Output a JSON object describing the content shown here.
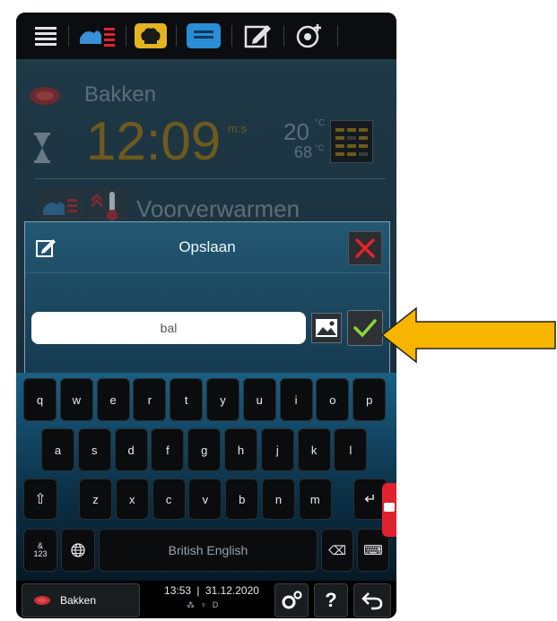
{
  "program": {
    "name": "Bakken",
    "time": "12:09",
    "time_unit": "m:s",
    "temp_set": "20",
    "temp_unit": "°C",
    "temp_actual": "68",
    "temp_actual_unit": "°C",
    "step_label": "Voorverwarmen"
  },
  "dialog": {
    "title": "Opslaan",
    "input_value": "bal"
  },
  "keyboard": {
    "row1": [
      "q",
      "w",
      "e",
      "r",
      "t",
      "y",
      "u",
      "i",
      "o",
      "p"
    ],
    "row2": [
      "a",
      "s",
      "d",
      "f",
      "g",
      "h",
      "j",
      "k",
      "l"
    ],
    "row3": [
      "z",
      "x",
      "c",
      "v",
      "b",
      "n",
      "m"
    ],
    "shift_glyph": "⇧",
    "enter_glyph": "↵",
    "numbers_line1": "&",
    "numbers_line2": "123",
    "globe_glyph": "🌐",
    "space_label": "British English",
    "backspace_glyph": "⌫",
    "hide_glyph": "⌨"
  },
  "bottombar": {
    "program_label": "Bakken",
    "time": "13:53",
    "date": "31.12.2020",
    "status_icons": "⁂ ♆ D",
    "help_label": "?",
    "back_glyph": "↩"
  },
  "colors": {
    "accent_yellow": "#e3b41f",
    "confirm_green": "#8dd63a",
    "close_red": "#e3222d",
    "arrow_yellow": "#f7b500"
  }
}
